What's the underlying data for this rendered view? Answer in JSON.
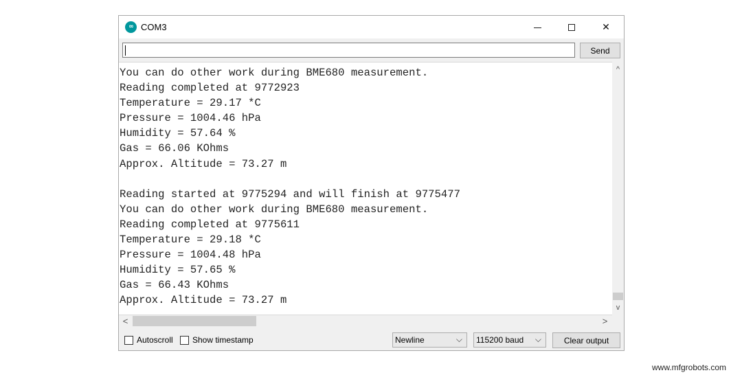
{
  "window": {
    "title": "COM3",
    "app_icon_glyph": "∞",
    "controls": {
      "minimize": "—",
      "maximize": "☐",
      "close": "✕"
    }
  },
  "input": {
    "value": "",
    "placeholder": "",
    "send_label": "Send"
  },
  "output": {
    "lines": [
      "You can do other work during BME680 measurement.",
      "Reading completed at 9772923",
      "Temperature = 29.17 *C",
      "Pressure = 1004.46 hPa",
      "Humidity = 57.64 %",
      "Gas = 66.06 KOhms",
      "Approx. Altitude = 73.27 m",
      "",
      "Reading started at 9775294 and will finish at 9775477",
      "You can do other work during BME680 measurement.",
      "Reading completed at 9775611",
      "Temperature = 29.18 *C",
      "Pressure = 1004.48 hPa",
      "Humidity = 57.65 %",
      "Gas = 66.43 KOhms",
      "Approx. Altitude = 73.27 m"
    ]
  },
  "scroll": {
    "up": "^",
    "down": "v",
    "left": "<",
    "right": ">"
  },
  "footer": {
    "autoscroll_label": "Autoscroll",
    "autoscroll_checked": false,
    "timestamp_label": "Show timestamp",
    "timestamp_checked": false,
    "line_ending": "Newline",
    "baud_rate": "115200 baud",
    "clear_label": "Clear output",
    "dropdown_arrow": "⌵"
  },
  "watermark": "www.mfgrobots.com"
}
